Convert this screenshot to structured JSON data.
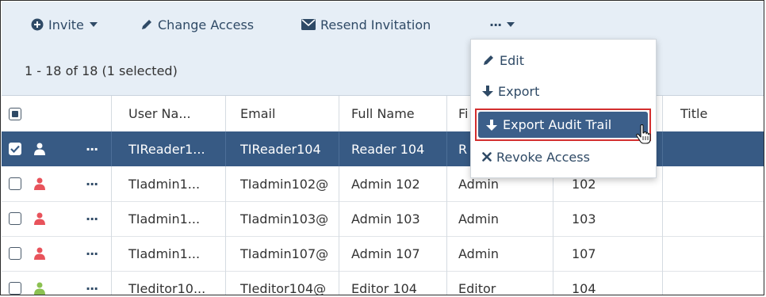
{
  "toolbar": {
    "invite_label": "Invite",
    "change_access_label": "Change Access",
    "resend_label": "Resend Invitation",
    "more_label": "···"
  },
  "list": {
    "count_text": "1 - 18 of 18 (1 selected)"
  },
  "columns": {
    "user_name": "User Na...",
    "email": "Email",
    "full_name": "Full Name",
    "first": "Fi",
    "title": "Title"
  },
  "rows": [
    {
      "user": "TIReader1...",
      "email": "TIReader104",
      "full_name": "Reader 104",
      "first": "R",
      "num": "",
      "selected": true,
      "icon_color": "#ffffff"
    },
    {
      "user": "TIadmin1...",
      "email": "TIadmin102@",
      "full_name": "Admin 102",
      "first": "Admin",
      "num": "102",
      "selected": false,
      "icon_color": "#e8535b"
    },
    {
      "user": "TIadmin1...",
      "email": "TIadmin103@",
      "full_name": "Admin 103",
      "first": "Admin",
      "num": "103",
      "selected": false,
      "icon_color": "#e8535b"
    },
    {
      "user": "TIadmin1...",
      "email": "TIadmin107@",
      "full_name": "Admin 107",
      "first": "Admin",
      "num": "107",
      "selected": false,
      "icon_color": "#e8535b"
    },
    {
      "user": "TIeditor10...",
      "email": "TIeditor104@",
      "full_name": "Editor 104",
      "first": "Editor",
      "num": "104",
      "selected": false,
      "icon_color": "#8cc152"
    }
  ],
  "menu": {
    "edit": "Edit",
    "export": "Export",
    "export_audit": "Export Audit Trail",
    "revoke": "Revoke Access"
  },
  "colors": {
    "toolbar_bg": "#e6eef6",
    "selected_row": "#375a84",
    "link_text": "#2f4a66",
    "highlight_border": "#d32f2f",
    "admin_icon": "#e8535b",
    "editor_icon": "#8cc152"
  },
  "icons": {
    "invite": "plus-circle-icon",
    "change_access": "pencil-icon",
    "resend": "envelope-icon",
    "caret": "caret-down-icon",
    "export": "arrow-down-icon",
    "revoke": "x-icon",
    "user": "user-icon",
    "row_menu": "ellipsis-icon",
    "cursor": "hand-pointer-icon"
  }
}
